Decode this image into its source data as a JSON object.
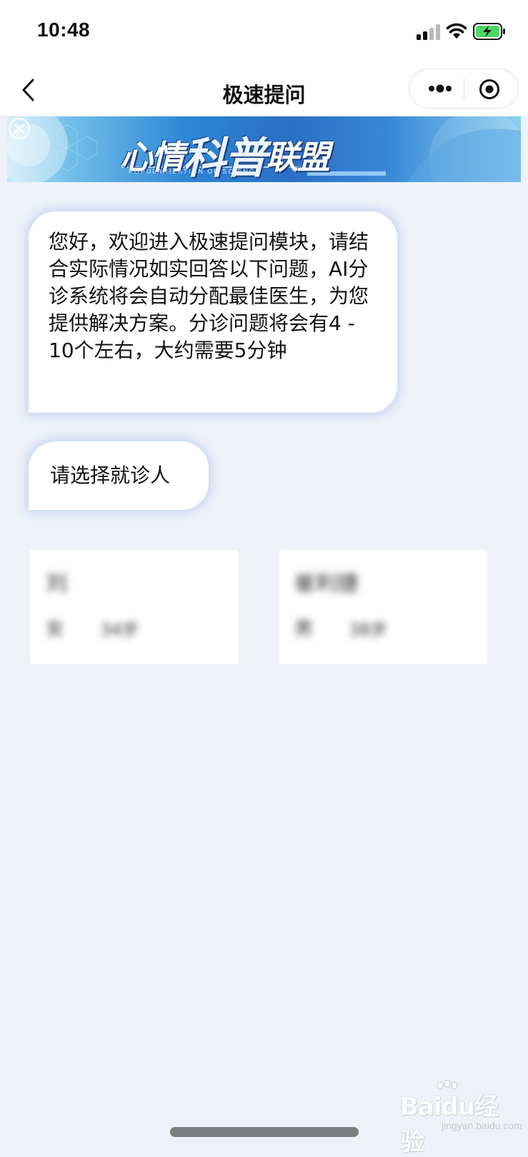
{
  "status_bar": {
    "time": "10:48",
    "signal_icon": "cellular-signal-icon",
    "wifi_icon": "wifi-icon",
    "battery_icon": "battery-charging-icon",
    "battery_color": "#4cd964"
  },
  "nav": {
    "title": "极速提问",
    "back_icon": "chevron-left-icon",
    "more_icon": "more-dots-icon",
    "close_icon": "target-circle-icon"
  },
  "banner": {
    "title_part1": "心情",
    "title_part2": "科普",
    "title_part3": "联盟",
    "subtitle": "POPULARIZATION OF SCIENCE",
    "close_icon": "close-circle-icon"
  },
  "chat": {
    "welcome_message": "您好，欢迎进入极速提问模块，请结合实际情况如实回答以下问题，AI分诊系统将会自动分配最佳医生，为您提供解决方案。分诊问题将会有4 - 10个左右，大约需要5分钟",
    "prompt_message": "请选择就诊人"
  },
  "patients": [
    {
      "name": "刘",
      "gender": "女",
      "age": "34岁"
    },
    {
      "name": "崔利捷",
      "gender": "男",
      "age": "38岁"
    }
  ],
  "watermark": {
    "text": "Baidu经验",
    "sub": "jingyan.baidu.com"
  },
  "colors": {
    "background": "#eef2f8",
    "bubble_glow": "#96afeb"
  }
}
